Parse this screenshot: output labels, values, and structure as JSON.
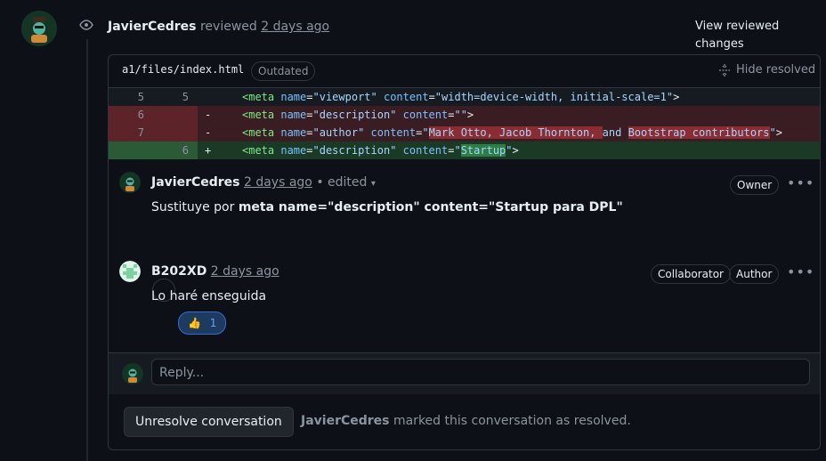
{
  "review": {
    "author": "JavierCedres",
    "action": "reviewed",
    "time": "2 days ago",
    "view_changes": "View reviewed changes"
  },
  "file": {
    "path": "a1/files/index.html",
    "badge": "Outdated",
    "hide_resolved": "Hide resolved"
  },
  "diff": {
    "lines": [
      {
        "old": "5",
        "new": "5",
        "sign": ""
      },
      {
        "old": "6",
        "new": "",
        "sign": "-"
      },
      {
        "old": "7",
        "new": "",
        "sign": "-"
      },
      {
        "old": "",
        "new": "6",
        "sign": "+"
      }
    ]
  },
  "comments": [
    {
      "author": "JavierCedres",
      "time": "2 days ago",
      "edited": "• edited",
      "role_badges": [
        "Owner"
      ],
      "body_prefix": "Sustituye por ",
      "body_bold": "meta name=\"description\" content=\"Startup para DPL\""
    },
    {
      "author": "B202XD",
      "time": "2 days ago",
      "role_badges": [
        "Collaborator",
        "Author"
      ],
      "body": "Lo haré enseguida",
      "reaction": {
        "emoji": "👍",
        "count": "1"
      }
    }
  ],
  "reply": {
    "placeholder": "Reply..."
  },
  "footer": {
    "button": "Unresolve conversation",
    "resolved_by": "JavierCedres",
    "resolved_text": "marked this conversation as resolved."
  }
}
